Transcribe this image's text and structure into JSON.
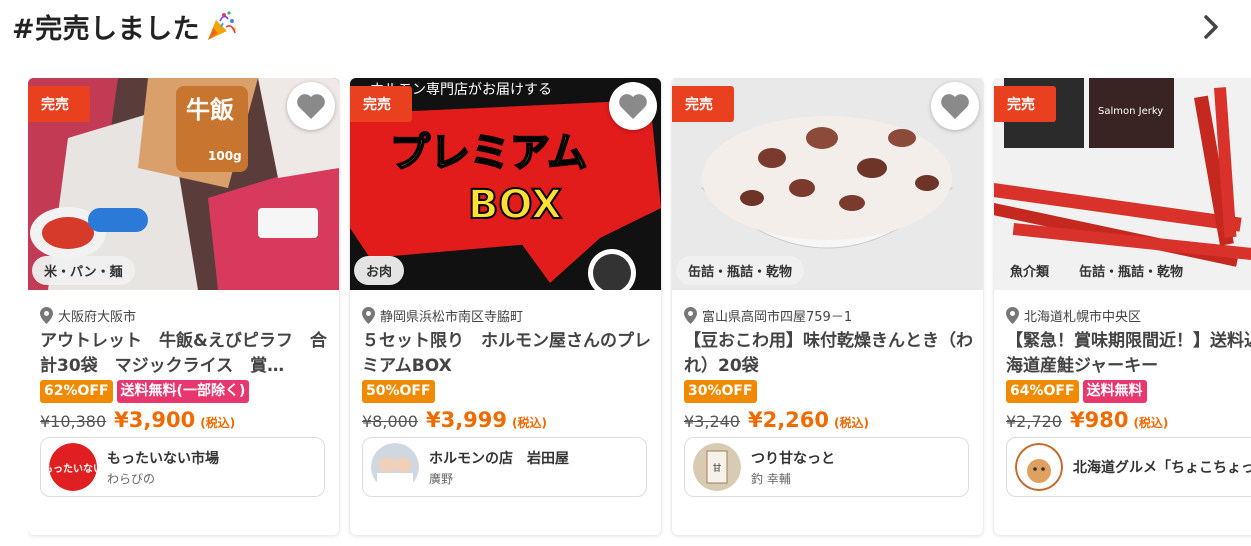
{
  "header": {
    "title": "#完売しました",
    "party_icon": "party-popper-icon",
    "next_icon": "chevron-right-icon"
  },
  "colors": {
    "sold": "#e9401f",
    "discount": "#f08a00",
    "free_ship": "#e8366e",
    "price": "#f06a00"
  },
  "cards": [
    {
      "sold_label": "完売",
      "categories": [
        "米・パン・麺"
      ],
      "location": "大阪府大阪市",
      "title": "アウトレット　牛飯&えびピラフ　合計30袋　マジックライス　賞…",
      "discount": "62%OFF",
      "shipping": "送料無料(一部除く)",
      "original_price": "¥10,380",
      "price": "¥3,900",
      "tax_label": "(税込)",
      "seller_name": "もったいない市場",
      "seller_sub": "わらびの",
      "image_text": "牛飯",
      "image_text2": "100g"
    },
    {
      "sold_label": "完売",
      "categories": [
        "お肉"
      ],
      "location": "静岡県浜松市南区寺脇町",
      "title": "５セット限り　ホルモン屋さんのプレミアムBOX",
      "discount": "50%OFF",
      "shipping": "",
      "original_price": "¥8,000",
      "price": "¥3,999",
      "tax_label": "(税込)",
      "seller_name": "ホルモンの店　岩田屋",
      "seller_sub": "廣野",
      "image_text": "ホルモン専門店がお届けする",
      "image_text2": "プレミアム",
      "image_text3": "BOX"
    },
    {
      "sold_label": "完売",
      "categories": [
        "缶詰・瓶詰・乾物"
      ],
      "location": "富山県高岡市四屋759－1",
      "title": "【豆おこわ用】味付乾燥きんとき（われ）20袋",
      "discount": "30%OFF",
      "shipping": "",
      "original_price": "¥3,240",
      "price": "¥2,260",
      "tax_label": "(税込)",
      "seller_name": "つり甘なっと",
      "seller_sub": "釣 幸輔"
    },
    {
      "sold_label": "完売",
      "categories": [
        "魚介類",
        "缶詰・瓶詰・乾物"
      ],
      "location": "北海道札幌市中央区",
      "title": "【緊急！賞味期限間近！】送料込！北海道産鮭ジャーキー",
      "discount": "64%OFF",
      "shipping": "送料無料",
      "original_price": "¥2,720",
      "price": "¥980",
      "tax_label": "(税込)",
      "seller_name": "北海道グルメ「ちょこちょっぷ」",
      "seller_sub": "",
      "image_text": "Salmon Jerky"
    }
  ]
}
